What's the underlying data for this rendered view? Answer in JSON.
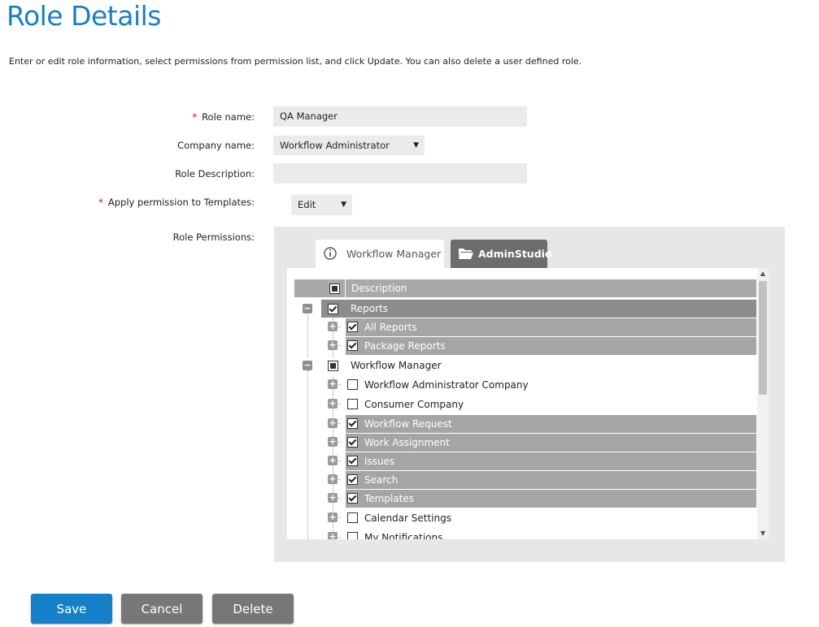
{
  "page": {
    "title": "Role Details",
    "intro": "Enter or edit role information, select permissions from permission list, and click Update. You can also delete a user defined role."
  },
  "form": {
    "role_name_label": "Role name:",
    "role_name_value": "QA Manager",
    "company_label": "Company name:",
    "company_value": "Workflow Administrator",
    "description_label": "Role Description:",
    "description_value": "",
    "apply_label": "Apply permission to Templates:",
    "apply_value": "Edit",
    "permissions_label": "Role Permissions:",
    "required_mark": "*"
  },
  "tabs": {
    "workflow_manager": "Workflow Manager",
    "adminstudio": "AdminStudio"
  },
  "tree": {
    "header": "Description",
    "groups": [
      {
        "label": "Reports",
        "state": "checked",
        "children": [
          {
            "label": "All Reports",
            "checked": true
          },
          {
            "label": "Package Reports",
            "checked": true
          }
        ]
      },
      {
        "label": "Workflow Manager",
        "state": "partial",
        "children": [
          {
            "label": "Workflow Administrator Company",
            "checked": false
          },
          {
            "label": "Consumer Company",
            "checked": false
          },
          {
            "label": "Workflow Request",
            "checked": true
          },
          {
            "label": "Work Assignment",
            "checked": true
          },
          {
            "label": "Issues",
            "checked": true
          },
          {
            "label": "Search",
            "checked": true
          },
          {
            "label": "Templates",
            "checked": true
          },
          {
            "label": "Calendar Settings",
            "checked": false
          },
          {
            "label": "My Notifications",
            "checked": false
          }
        ]
      }
    ]
  },
  "buttons": {
    "save": "Save",
    "cancel": "Cancel",
    "delete": "Delete"
  }
}
